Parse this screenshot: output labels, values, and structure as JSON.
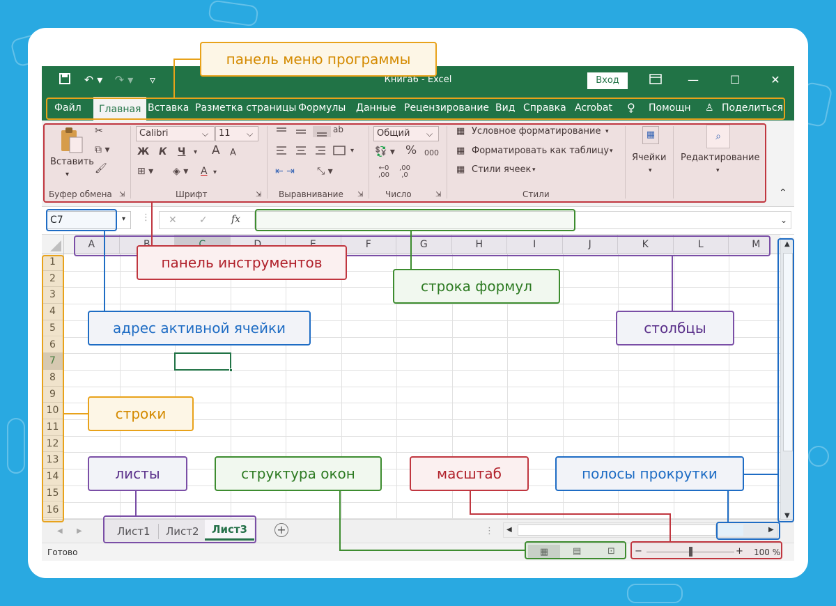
{
  "window": {
    "title": "Книга6  -  Excel",
    "sign_in": "Вход"
  },
  "menu": {
    "tabs": [
      "Файл",
      "Главная",
      "Вставка",
      "Разметка страницы",
      "Формулы",
      "Данные",
      "Рецензирование",
      "Вид",
      "Справка",
      "Acrobat"
    ],
    "help": "Помощн",
    "share": "Поделиться"
  },
  "ribbon": {
    "paste": "Вставить",
    "clipboard": "Буфер обмена",
    "font_name": "Calibri",
    "font_size": "11",
    "bold": "Ж",
    "italic": "К",
    "underline": "Ч",
    "grow": "A",
    "shrink": "A",
    "font_color": "A",
    "font_group": "Шрифт",
    "wrap": "ab",
    "alignment_group": "Выравнивание",
    "number_format": "Общий",
    "percent": "%",
    "thousands": "000",
    "dec_inc": "←0  ,00",
    "dec_dec": ",00  ,0",
    "number_group": "Число",
    "cond_format": "Условное форматирование",
    "format_table": "Форматировать как таблицу",
    "cell_styles": "Стили ячеек",
    "styles_group": "Стили",
    "cells": "Ячейки",
    "editing": "Редактирование"
  },
  "formula_bar": {
    "cell_address": "C7",
    "cancel": "✕",
    "enter": "✓",
    "fx": "fx",
    "value": ""
  },
  "sheet": {
    "columns": [
      "A",
      "B",
      "C",
      "D",
      "E",
      "F",
      "G",
      "H",
      "I",
      "J",
      "K",
      "L",
      "M"
    ],
    "rows": [
      "1",
      "2",
      "3",
      "4",
      "5",
      "6",
      "7",
      "8",
      "9",
      "10",
      "11",
      "12",
      "13",
      "14",
      "15",
      "16"
    ]
  },
  "sheets": {
    "tabs": [
      "Лист1",
      "Лист2",
      "Лист3"
    ],
    "active": "Лист3",
    "add": "+"
  },
  "status": {
    "text": "Готово",
    "zoom_minus": "−",
    "zoom_plus": "+",
    "zoom_level": "100 %",
    "zoom_value": 0.5
  },
  "annotations": {
    "menu": "панель меню программы",
    "ribbon": "панель инструментов",
    "formula": "строка формул",
    "address": "адрес активной ячейки",
    "columns": "столбцы",
    "rows": "строки",
    "sheets": "листы",
    "views": "структура окон",
    "zoom": "масштаб",
    "scroll": "полосы прокрутки"
  },
  "colors": {
    "excel_green": "#217346",
    "orange": "#e8a21a",
    "red": "#c0363f",
    "blue": "#1e6cc4",
    "green": "#3d8c2f",
    "purple": "#7a4ea6",
    "background": "#29a9e1"
  }
}
